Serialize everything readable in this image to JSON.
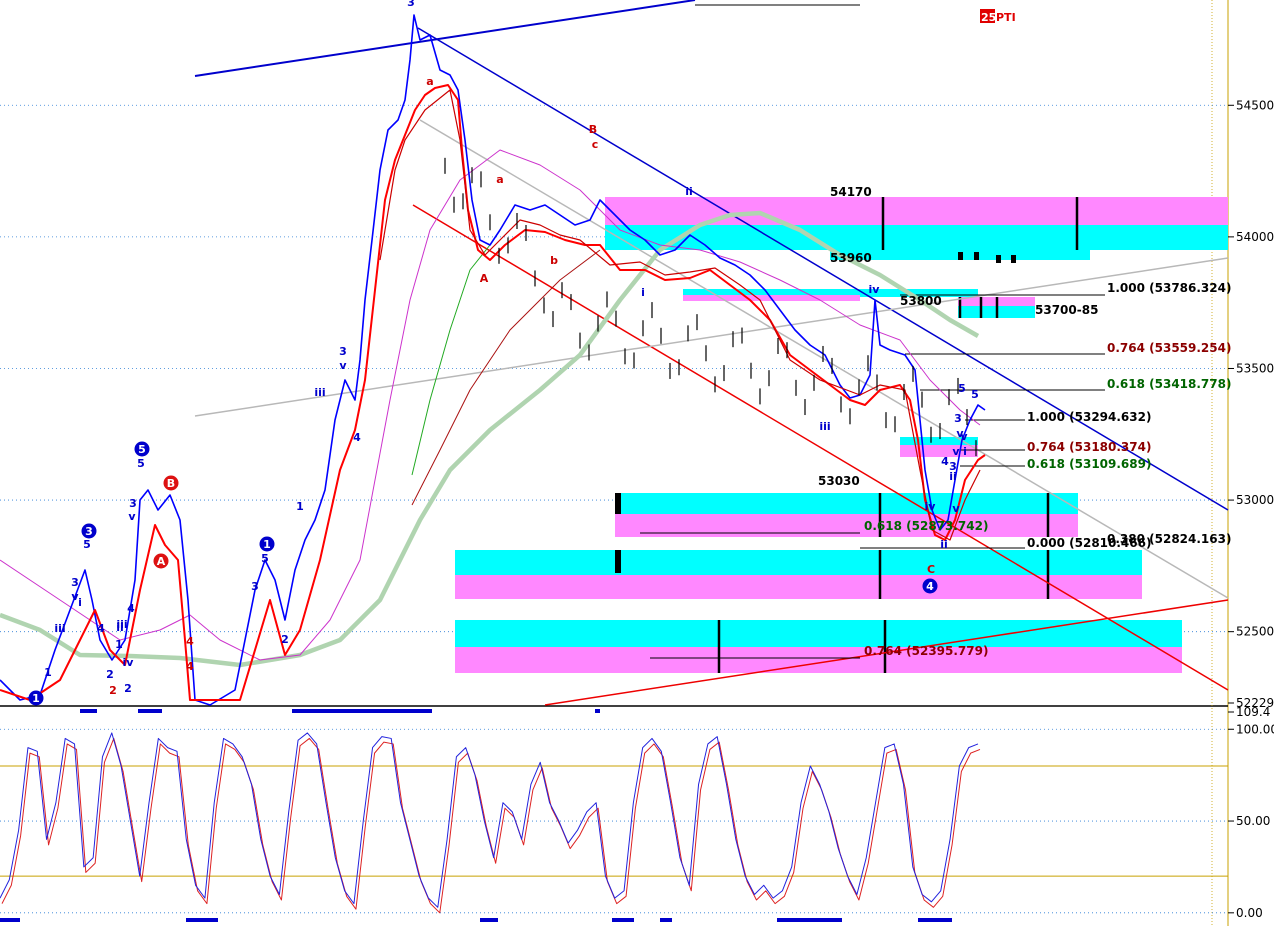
{
  "chart_data": {
    "type": "line",
    "title": "",
    "badge": {
      "text_a": "25",
      "text_b": "PTI",
      "color": "#e00000"
    },
    "price_axis": {
      "ticks": [
        "54500.",
        "54000.",
        "53500.",
        "53000.",
        "52500.",
        "52229."
      ],
      "range": [
        52229,
        54900
      ]
    },
    "osc_axis": {
      "ticks": [
        "109.4",
        "100.00",
        "50.00",
        "0.00"
      ],
      "range": [
        -5,
        109.4
      ],
      "overbought": 80,
      "oversold": 20
    },
    "levels": [
      {
        "text": "54170",
        "color": "#000000"
      },
      {
        "text": "53960",
        "color": "#000000"
      },
      {
        "text": "53800",
        "color": "#000000"
      },
      {
        "text": "53700-85",
        "color": "#000000"
      },
      {
        "text": "53030",
        "color": "#000000"
      },
      {
        "text": "1.000 (53786.324)",
        "color": "#000000"
      },
      {
        "text": "0.764 (53559.254)",
        "color": "#8b0000"
      },
      {
        "text": "0.618 (53418.778)",
        "color": "#006400"
      },
      {
        "text": "1.000 (53294.632)",
        "color": "#000000"
      },
      {
        "text": "0.764 (53180.374)",
        "color": "#8b0000"
      },
      {
        "text": "0.618 (53109.689)",
        "color": "#006400"
      },
      {
        "text": "0.618 (52873.742)",
        "color": "#006400"
      },
      {
        "text": "0.000 (52810.466)",
        "color": "#000000"
      },
      {
        "text": "0.380 (52824.163)",
        "color": "#000000"
      },
      {
        "text": "0.764 (52395.779)",
        "color": "#8b0000"
      }
    ],
    "wave_labels": [
      {
        "text": "3",
        "color": "#0000cc"
      },
      {
        "text": "a",
        "color": "#cc0000"
      },
      {
        "text": "B",
        "color": "#cc0000"
      },
      {
        "text": "c",
        "color": "#cc0000"
      },
      {
        "text": "ii",
        "color": "#0000cc"
      },
      {
        "text": "a",
        "color": "#cc0000"
      },
      {
        "text": "b",
        "color": "#cc0000"
      },
      {
        "text": "A",
        "color": "#cc0000"
      },
      {
        "text": "i",
        "color": "#0000cc"
      },
      {
        "text": "iv",
        "color": "#0000cc"
      },
      {
        "text": "iii",
        "color": "#0000cc"
      },
      {
        "text": "3",
        "color": "#0000cc"
      },
      {
        "text": "v",
        "color": "#0000cc"
      },
      {
        "text": "iii",
        "color": "#0000cc"
      },
      {
        "text": "4",
        "color": "#0000cc"
      },
      {
        "text": "5",
        "color": "#0000cc"
      },
      {
        "text": "3",
        "color": "#0000cc"
      },
      {
        "text": "v",
        "color": "#0000cc"
      },
      {
        "text": "ii",
        "color": "#0000cc"
      },
      {
        "text": "iv",
        "color": "#0000cc"
      },
      {
        "text": "v",
        "color": "#0000cc"
      },
      {
        "text": "ii",
        "color": "#0000cc"
      },
      {
        "text": "C",
        "color": "#cc0000"
      },
      {
        "text": "i",
        "color": "#0000cc"
      },
      {
        "text": "v",
        "color": "#0000cc"
      },
      {
        "text": "5",
        "color": "#0000cc"
      },
      {
        "text": "3",
        "color": "#0000cc"
      },
      {
        "text": "v",
        "color": "#0000cc"
      },
      {
        "text": "4",
        "color": "#0000cc"
      },
      {
        "text": "iii",
        "color": "#0000cc"
      },
      {
        "text": "i",
        "color": "#0000cc"
      },
      {
        "text": "1",
        "color": "#0000cc"
      },
      {
        "text": "2",
        "color": "#0000cc"
      },
      {
        "text": "1",
        "color": "#0000cc"
      },
      {
        "text": "5",
        "color": "#0000cc"
      },
      {
        "text": "3",
        "color": "#0000cc"
      },
      {
        "text": "v",
        "color": "#0000cc"
      },
      {
        "text": "4",
        "color": "#0000cc"
      },
      {
        "text": "iii",
        "color": "#0000cc"
      },
      {
        "text": "iv",
        "color": "#0000cc"
      },
      {
        "text": "ii",
        "color": "#0000cc"
      },
      {
        "text": "2",
        "color": "#0000cc"
      },
      {
        "text": "4",
        "color": "#cc0000"
      },
      {
        "text": "5",
        "color": "#0000cc"
      },
      {
        "text": "3",
        "color": "#0000cc"
      },
      {
        "text": "v",
        "color": "#0000cc"
      },
      {
        "text": "4",
        "color": "#0000cc"
      },
      {
        "text": "2",
        "color": "#0000cc"
      },
      {
        "text": "3",
        "color": "#0000cc"
      },
      {
        "text": "5",
        "color": "#0000cc"
      },
      {
        "text": "1",
        "color": "#0000cc"
      },
      {
        "text": "2",
        "color": "#cc0000"
      },
      {
        "text": "4",
        "color": "#cc0000"
      },
      {
        "text": "1",
        "color": "#0000cc"
      }
    ],
    "circled_labels": [
      {
        "text": "5",
        "fill": "#0000cc"
      },
      {
        "text": "B",
        "fill": "#dd1111"
      },
      {
        "text": "A",
        "fill": "#dd1111"
      },
      {
        "text": "3",
        "fill": "#0000cc"
      },
      {
        "text": "1",
        "fill": "#0000cc"
      },
      {
        "text": "4",
        "fill": "#0000cc"
      },
      {
        "text": "1",
        "fill": "#0000cc"
      }
    ],
    "colors": {
      "price": "#0000ff",
      "ma_red": "#ff0000",
      "ma_blue": "#0000ff",
      "ma_green": "#b0d4b0",
      "ma_magenta": "#cc33cc",
      "zone_cyan": "#00ffff",
      "zone_magenta": "#ff88ff",
      "osc_k": "#2222dd",
      "osc_d": "#dd2222",
      "osc_band": "#c8a000",
      "channel_blue": "#0000cc",
      "channel_red": "#ee0000",
      "channel_gray": "#b8b8b8"
    }
  }
}
